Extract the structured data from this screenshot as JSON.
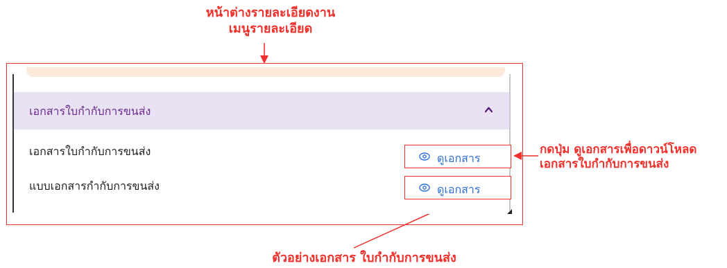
{
  "annotations": {
    "top_line1": "หน้าต่างรายละเอียดงาน",
    "top_line2": "เมนูรายละเอียด",
    "right_line1": "กดปุ่ม ดูเอกสารเพื่อดาวน์โหลด",
    "right_line2": "เอกสารใบกำกับการขนส่ง",
    "bottom": "ตัวอย่างเอกสาร ใบกำกับการขนส่ง"
  },
  "accordion": {
    "title": "เอกสารใบกำกับการขนส่ง",
    "expanded": true,
    "icon": "chevron-up-icon",
    "items": [
      {
        "label": "เอกสารใบกำกับการขนส่ง",
        "button_label": "ดูเอกสาร",
        "button_icon": "eye-icon"
      },
      {
        "label": "แบบเอกสารกำกับการขนส่ง",
        "button_label": "ดูเอกสาร",
        "button_icon": "eye-icon"
      }
    ]
  },
  "colors": {
    "annotation": "#f0302a",
    "header_bg": "#e8e2f4",
    "header_text": "#6a2a8c",
    "link": "#2f6fd8"
  }
}
